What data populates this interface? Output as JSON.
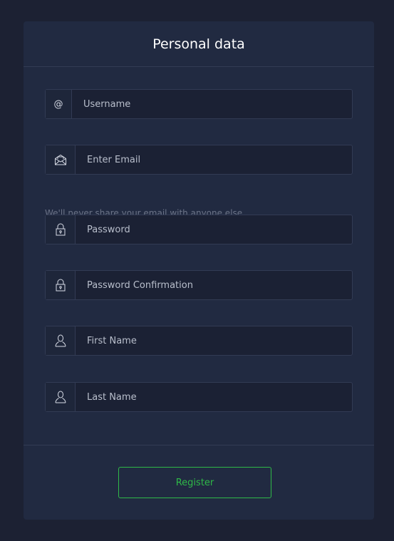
{
  "form": {
    "title": "Personal data",
    "username": {
      "addon": "@",
      "placeholder": "Username"
    },
    "email": {
      "icon": "envelope-icon",
      "placeholder": "Enter Email",
      "help": "We'll never share your email with anyone else."
    },
    "password": {
      "icon": "lock-icon",
      "placeholder": "Password"
    },
    "password_confirmation": {
      "icon": "lock-icon",
      "placeholder": "Password Confirmation"
    },
    "first_name": {
      "icon": "user-icon",
      "placeholder": "First Name"
    },
    "last_name": {
      "icon": "user-icon",
      "placeholder": "Last Name"
    },
    "submit_label": "Register"
  },
  "colors": {
    "background": "#1c2133",
    "card": "#212a41",
    "border": "#323b54",
    "accent": "#2fb948",
    "muted_text": "#6c7488"
  }
}
